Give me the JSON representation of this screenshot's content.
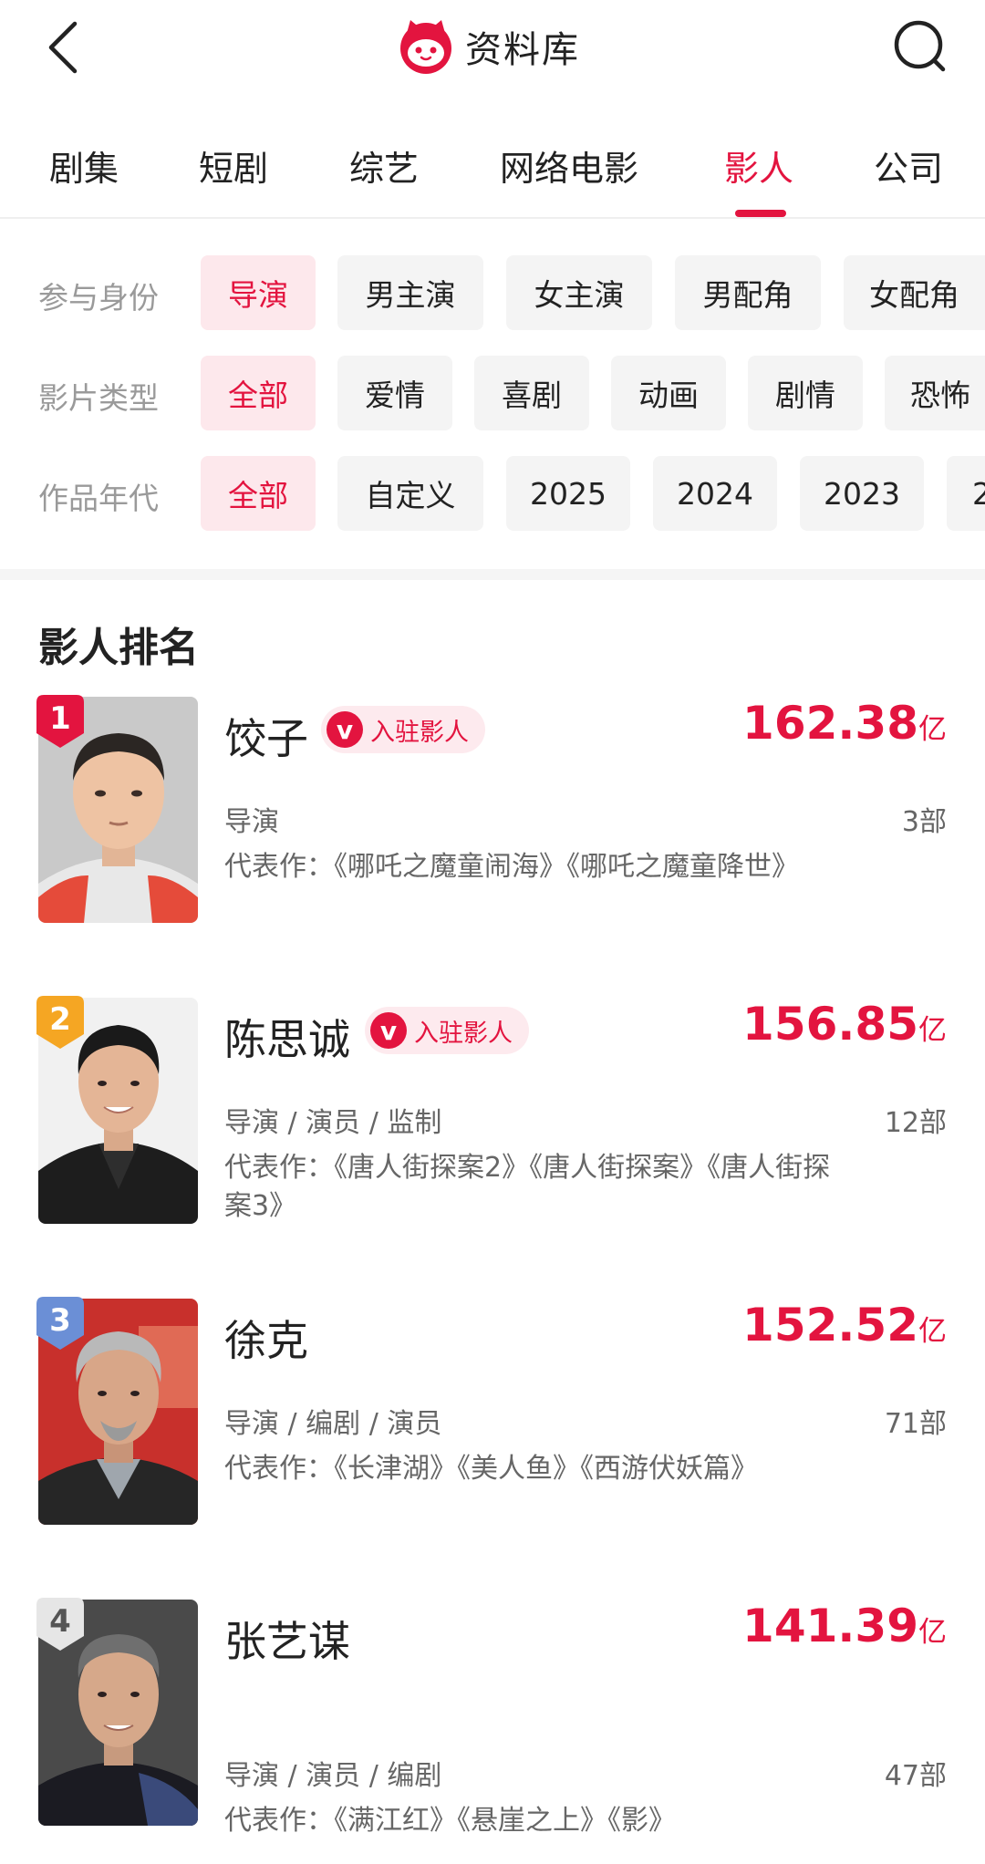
{
  "header": {
    "title": "资料库",
    "back_icon": "chevron-left-icon",
    "search_icon": "search-icon",
    "logo_icon": "cat-logo-icon"
  },
  "tabs": [
    {
      "label": "剧集",
      "active": false
    },
    {
      "label": "短剧",
      "active": false
    },
    {
      "label": "综艺",
      "active": false
    },
    {
      "label": "网络电影",
      "active": false
    },
    {
      "label": "影人",
      "active": true
    },
    {
      "label": "公司",
      "active": false
    }
  ],
  "filters": {
    "identity": {
      "label": "参与身份",
      "options": [
        "导演",
        "男主演",
        "女主演",
        "男配角",
        "女配角"
      ],
      "selected": "导演"
    },
    "genre": {
      "label": "影片类型",
      "options": [
        "全部",
        "爱情",
        "喜剧",
        "动画",
        "剧情",
        "恐怖"
      ],
      "selected": "全部"
    },
    "era": {
      "label": "作品年代",
      "options": [
        "全部",
        "自定义",
        "2025",
        "2024",
        "2023",
        "2"
      ],
      "selected": "全部"
    }
  },
  "ranking": {
    "title": "影人排名",
    "badge_text": "入驻影人",
    "badge_icon": "v",
    "items": [
      {
        "rank": "1",
        "name": "饺子",
        "verified": true,
        "box_office": "162.38",
        "unit": "亿",
        "roles": "导演",
        "count": "3部",
        "works": "代表作：《哪吒之魔童闹海》《哪吒之魔童降世》"
      },
      {
        "rank": "2",
        "name": "陈思诚",
        "verified": true,
        "box_office": "156.85",
        "unit": "亿",
        "roles": "导演 / 演员 / 监制",
        "count": "12部",
        "works": "代表作：《唐人街探案2》《唐人街探案》《唐人街探案3》"
      },
      {
        "rank": "3",
        "name": "徐克",
        "verified": false,
        "box_office": "152.52",
        "unit": "亿",
        "roles": "导演 / 编剧 / 演员",
        "count": "71部",
        "works": "代表作：《长津湖》《美人鱼》《西游伏妖篇》"
      },
      {
        "rank": "4",
        "name": "张艺谋",
        "verified": false,
        "box_office": "141.39",
        "unit": "亿",
        "roles": "导演 / 演员 / 编剧",
        "count": "47部",
        "works": "代表作：《满江红》《悬崖之上》《影》"
      }
    ]
  },
  "colors": {
    "accent": "#e3143f",
    "rank1": "#e3143f",
    "rank2": "#f5a623",
    "rank3": "#6b8fd6",
    "rank4": "#e6e6e6"
  }
}
